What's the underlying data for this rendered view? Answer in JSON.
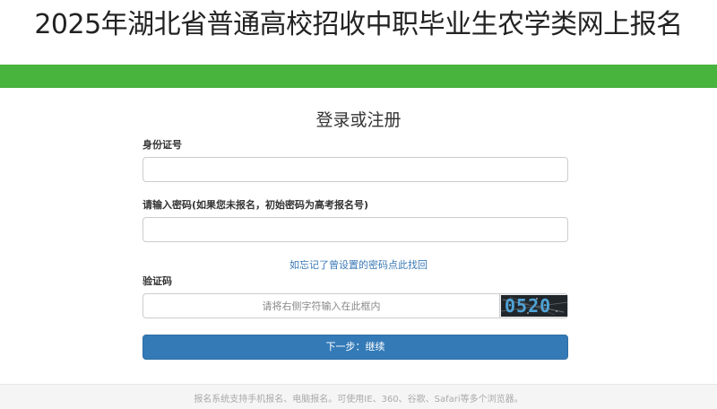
{
  "header": {
    "title": "2025年湖北省普通高校招收中职毕业生农学类网上报名"
  },
  "form": {
    "title": "登录或注册",
    "id_label": "身份证号",
    "id_value": "",
    "password_label": "请输入密码(如果您未报名，初始密码为高考报名号)",
    "password_value": "",
    "forgot_link": "如忘记了曾设置的密码点此找回",
    "captcha_label": "验证码",
    "captcha_placeholder": "请将右侧字符输入在此框内",
    "captcha_code": "0520",
    "next_button": "下一步：继续"
  },
  "footer": {
    "text": "报名系统支持手机报名、电脑报名。可使用IE、360、谷歌、Safari等多个浏览器。"
  },
  "colors": {
    "green_band": "#48b33d",
    "primary_button": "#337ab7",
    "link": "#3a78b5"
  }
}
